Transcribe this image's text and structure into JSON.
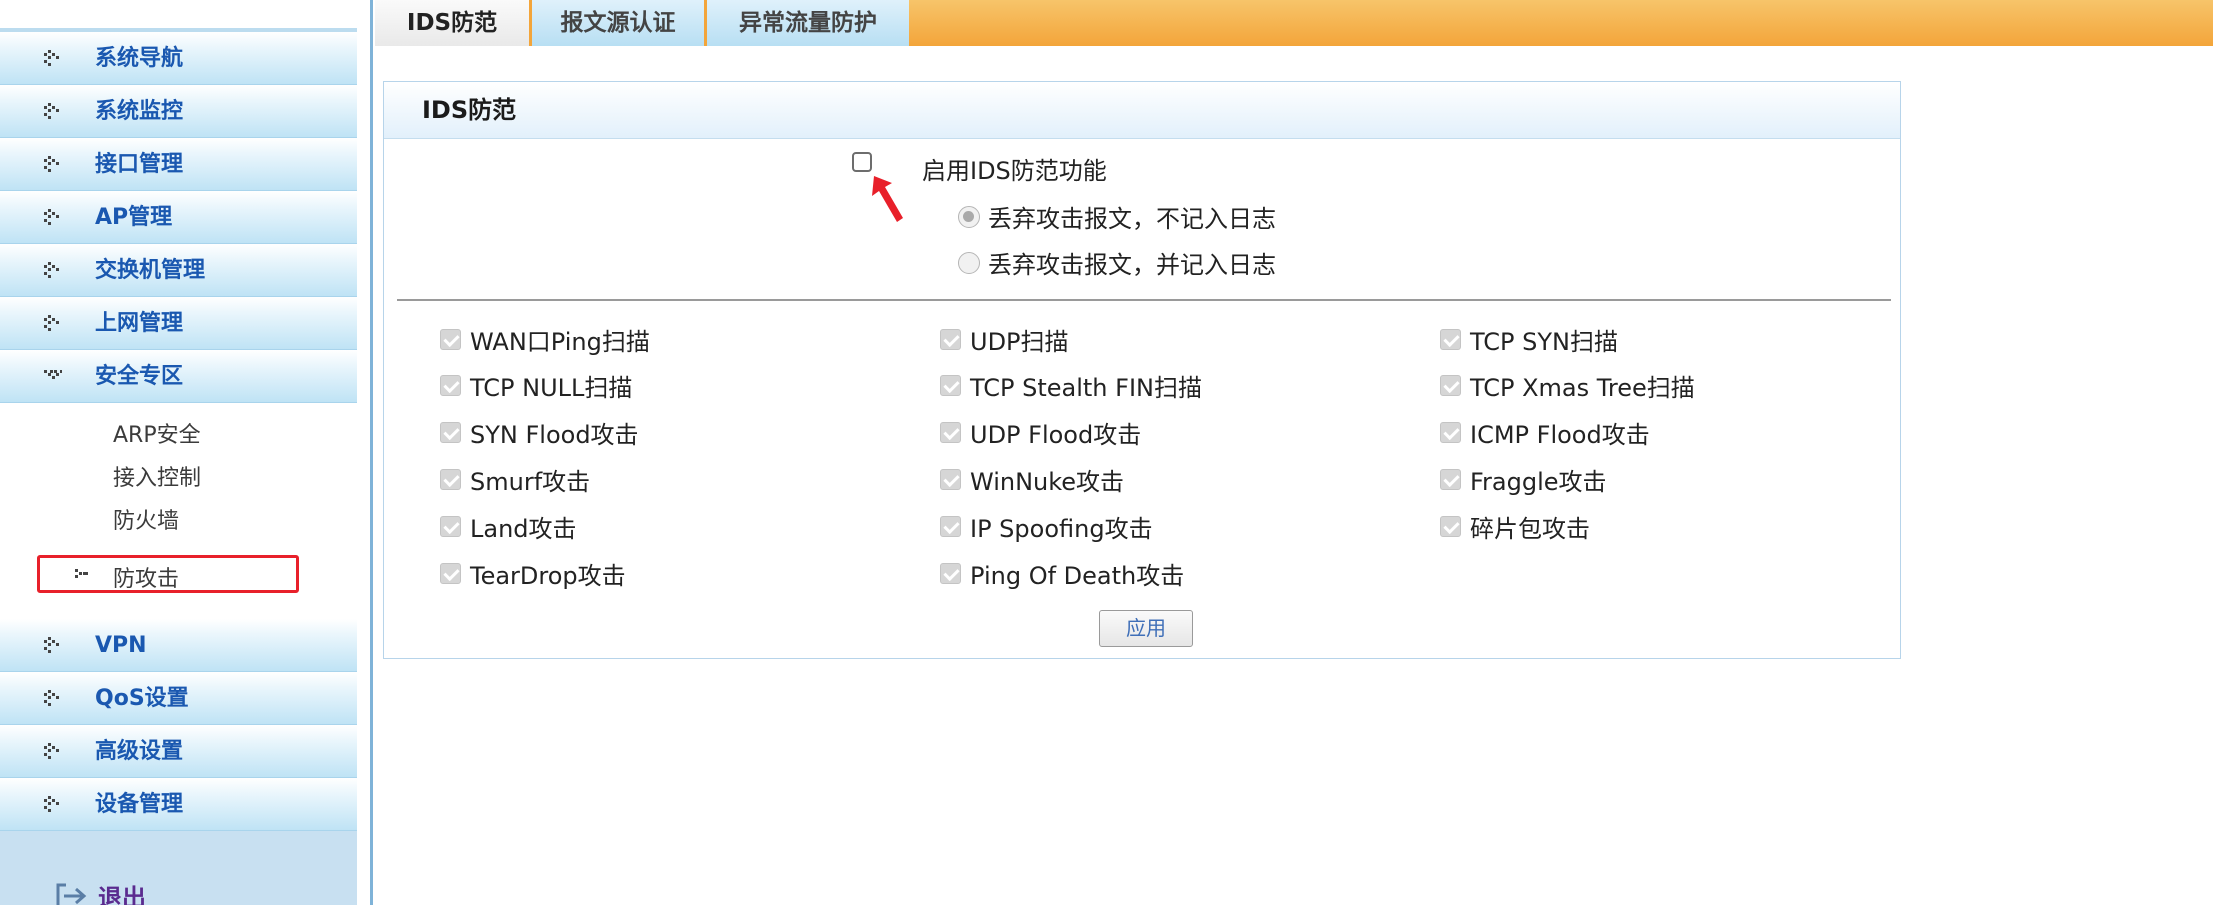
{
  "sidebar": {
    "items": [
      {
        "label": "系统导航"
      },
      {
        "label": "系统监控"
      },
      {
        "label": "接口管理"
      },
      {
        "label": "AP管理"
      },
      {
        "label": "交换机管理"
      },
      {
        "label": "上网管理"
      },
      {
        "label": "安全专区",
        "expanded": true
      },
      {
        "label": "VPN"
      },
      {
        "label": "QoS设置"
      },
      {
        "label": "高级设置"
      },
      {
        "label": "设备管理"
      }
    ],
    "security_submenu": [
      {
        "label": "ARP安全"
      },
      {
        "label": "接入控制"
      },
      {
        "label": "防火墙"
      },
      {
        "label": "防攻击",
        "active": true
      }
    ],
    "logout_label": "退出"
  },
  "tabs": [
    {
      "label": "IDS防范",
      "active": true
    },
    {
      "label": "报文源认证",
      "active": false
    },
    {
      "label": "异常流量防护",
      "active": false
    }
  ],
  "panel": {
    "title": "IDS防范",
    "enable_label": "启用IDS防范功能",
    "enable_checked": false,
    "radio_options": [
      {
        "label": "丢弃攻击报文，不记入日志",
        "checked": true
      },
      {
        "label": "丢弃攻击报文，并记入日志",
        "checked": false
      }
    ],
    "options": [
      {
        "label": "WAN口Ping扫描"
      },
      {
        "label": "UDP扫描"
      },
      {
        "label": "TCP SYN扫描"
      },
      {
        "label": "TCP NULL扫描"
      },
      {
        "label": "TCP Stealth FIN扫描"
      },
      {
        "label": "TCP Xmas Tree扫描"
      },
      {
        "label": "SYN Flood攻击"
      },
      {
        "label": "UDP Flood攻击"
      },
      {
        "label": "ICMP Flood攻击"
      },
      {
        "label": "Smurf攻击"
      },
      {
        "label": "WinNuke攻击"
      },
      {
        "label": "Fraggle攻击"
      },
      {
        "label": "Land攻击"
      },
      {
        "label": "IP Spoofing攻击"
      },
      {
        "label": "碎片包攻击"
      },
      {
        "label": "TearDrop攻击"
      },
      {
        "label": "Ping Of Death攻击"
      }
    ],
    "apply_label": "应用"
  },
  "colors": {
    "menu_text": "#1a58b0",
    "tab_bar": "#f3a53a",
    "highlight_box": "#e8202a",
    "annotation_arrow": "#e8202a"
  }
}
